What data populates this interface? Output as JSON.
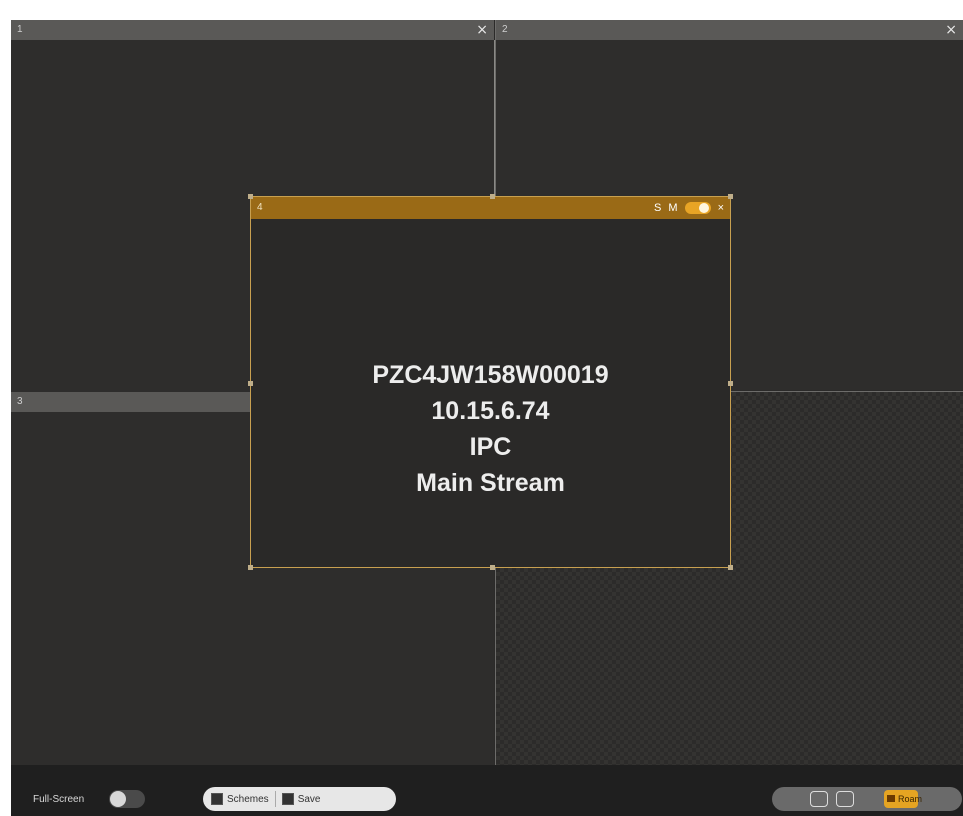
{
  "windows": {
    "w1": {
      "index": "1"
    },
    "w2": {
      "index": "2"
    },
    "w3": {
      "index": "3"
    },
    "w4": {
      "index": "4",
      "icons": {
        "snap": "S",
        "mode": "M"
      },
      "info": [
        "PZC4JW158W00019",
        "10.15.6.74",
        "IPC",
        "Main Stream"
      ]
    }
  },
  "close_glyph": "×",
  "bottombar": {
    "fullscreen_label": "Full-Screen",
    "schemes_label": "Schemes",
    "save_label": "Save",
    "roam_label": "Roam"
  },
  "colors": {
    "active_accent": "#9a6a16",
    "roam_accent": "#e5a422"
  }
}
